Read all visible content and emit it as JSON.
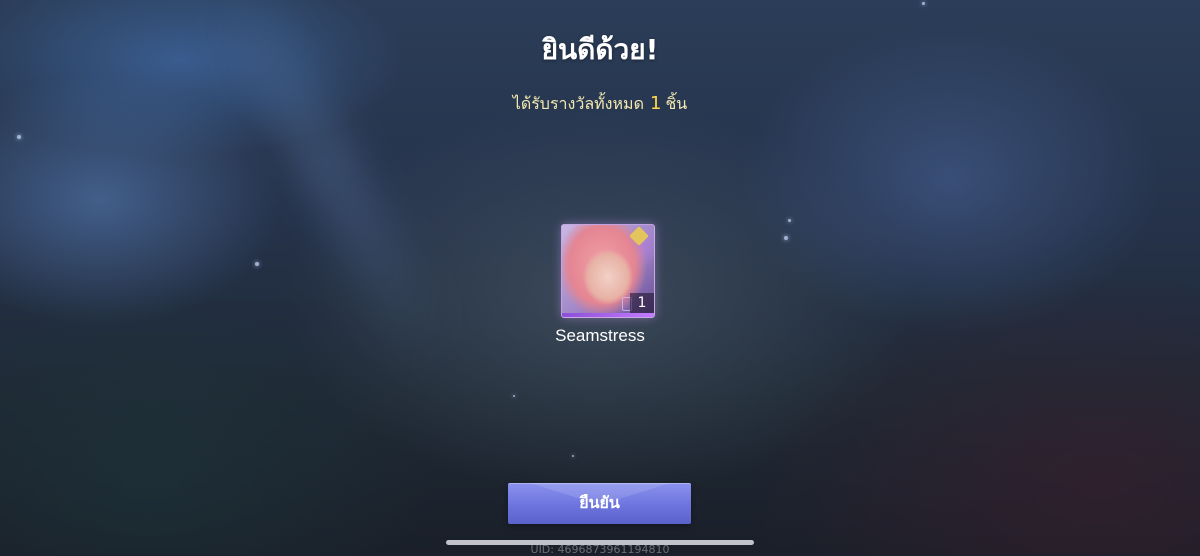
{
  "header": {
    "title": "ยินดีด้วย!",
    "subtitle_prefix": "ได้รับรางวัลทั้งหมด",
    "reward_count": "1",
    "subtitle_suffix": "ชิ้น"
  },
  "reward": {
    "name": "Seamstress",
    "quantity": "1",
    "rarity_color": "#a066e8"
  },
  "actions": {
    "confirm_label": "ยืนยัน"
  },
  "footer": {
    "uid": "UID: 4696873961194810"
  },
  "colors": {
    "accent_yellow": "#ffd94a",
    "button_purple": "#6d74de"
  }
}
